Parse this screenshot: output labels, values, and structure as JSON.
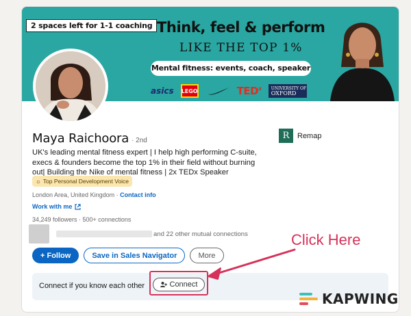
{
  "banner": {
    "badge": "2 spaces left for 1-1 coaching",
    "title": "Think, feel & perform",
    "subtitle": "LIKE THE TOP 1%",
    "pill": "Mental fitness: events, coach, speaker",
    "logos": {
      "asics": "asics",
      "lego": "LEGO",
      "ted": "TED",
      "ted_sup": "x",
      "oxford_line1": "UNIVERSITY OF",
      "oxford_line2": "OXFORD"
    }
  },
  "profile": {
    "name": "Maya Raichoora",
    "degree": "· 2nd",
    "headline": "UK's leading mental fitness expert | I help high performing C-suite, execs & founders become the top 1% in their field without burning out| Building the Nike of mental fitness | 2x TEDx Speaker",
    "voice_badge": "Top Personal Development Voice",
    "location": "London Area, United Kingdom · ",
    "contact_link": "Contact info",
    "work_link": "Work with me",
    "followers": "34,249 followers · 500+ connections",
    "mutual": "and 22 other mutual connections"
  },
  "remap": {
    "icon": "R",
    "label": "Remap"
  },
  "actions": {
    "follow": "+ Follow",
    "sales": "Save in Sales Navigator",
    "more": "More"
  },
  "connect": {
    "prompt": "Connect if you know each other",
    "button": "Connect"
  },
  "annotation": {
    "click_here": "Click Here"
  },
  "watermark": {
    "text": "KAPWING"
  },
  "colors": {
    "linkedin_blue": "#0a66c2",
    "banner_teal": "#2aa7a2",
    "highlight_pink": "#d6315a"
  }
}
